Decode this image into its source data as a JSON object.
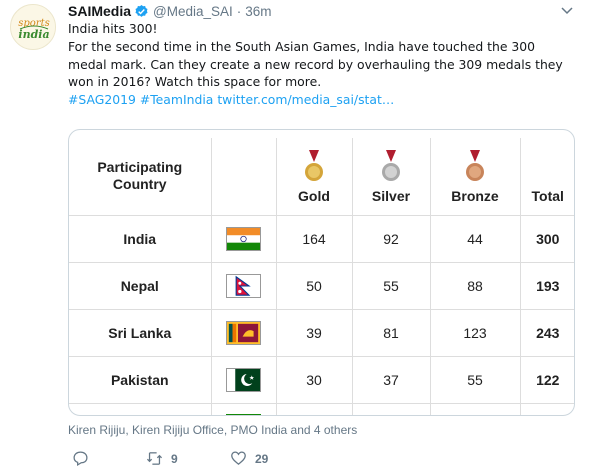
{
  "tweet": {
    "author_name": "SAIMedia",
    "handle": "@Media_SAI",
    "separator": "·",
    "time": "36m",
    "lines": [
      "India hits 300!",
      "For the second time in the South Asian Games, India have touched the 300 medal mark. Can they create a new record by overhauling the 309 medals they won in 2016? Watch this space for more."
    ],
    "hashtag1": "#SAG2019",
    "hashtag2": "#TeamIndia",
    "url": "twitter.com/media_sai/stat…",
    "liked_by": "Kiren Rijiju, Kiren Rijiju Office, PMO India and 4 others",
    "retweets": "9",
    "likes": "29",
    "avatar_text": [
      "sports",
      "india"
    ]
  },
  "table": {
    "headers": {
      "country_line1": "Participating",
      "country_line2": "Country",
      "gold": "Gold",
      "silver": "Silver",
      "bronze": "Bronze",
      "total": "Total"
    },
    "rows": [
      {
        "country": "India",
        "flag": "india-flag",
        "gold": "164",
        "silver": "92",
        "bronze": "44",
        "total": "300"
      },
      {
        "country": "Nepal",
        "flag": "nepal-flag",
        "gold": "50",
        "silver": "55",
        "bronze": "88",
        "total": "193"
      },
      {
        "country": "Sri Lanka",
        "flag": "sri-lanka-flag",
        "gold": "39",
        "silver": "81",
        "bronze": "123",
        "total": "243"
      },
      {
        "country": "Pakistan",
        "flag": "pakistan-flag",
        "gold": "30",
        "silver": "37",
        "bronze": "55",
        "total": "122"
      }
    ]
  },
  "colors": {
    "accent": "#1da1f2",
    "muted": "#657786",
    "gold": "#d4a53a",
    "silver": "#b8b8b8",
    "bronze": "#c8845a",
    "ribbon": "#b01e2f"
  }
}
